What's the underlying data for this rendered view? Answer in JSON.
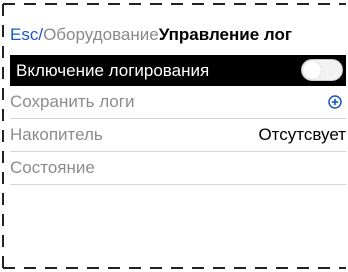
{
  "breadcrumb": {
    "root": "Esc",
    "separator": "/",
    "parent": "Оборудование",
    "current": "Управление лог"
  },
  "menu": {
    "items": [
      {
        "label": "Включение логирования",
        "toggle_on": false
      },
      {
        "label": "Сохранить логи",
        "icon": "plus-circle-icon"
      },
      {
        "label": "Накопитель",
        "value": "Отсутсвует"
      },
      {
        "label": "Состояние"
      }
    ]
  },
  "colors": {
    "link": "#1a56c8",
    "selected_row_bg": "#000000",
    "muted_text": "#8c8c8c"
  }
}
